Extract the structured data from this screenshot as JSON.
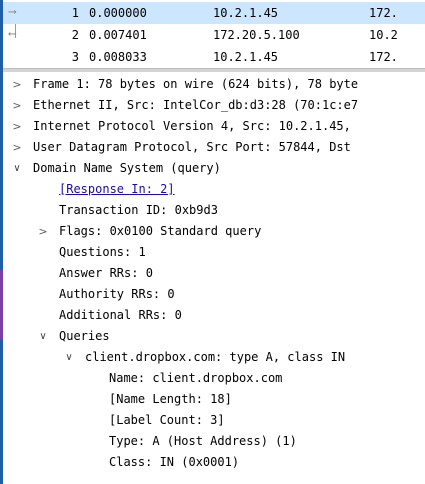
{
  "packets": [
    {
      "no": "1",
      "time": "0.000000",
      "source": "10.2.1.45",
      "destination": "172.",
      "relation": "request"
    },
    {
      "no": "2",
      "time": "0.007401",
      "source": "172.20.5.100",
      "destination": "10.2",
      "relation": "response"
    },
    {
      "no": "3",
      "time": "0.008033",
      "source": "10.2.1.45",
      "destination": "172.",
      "relation": "none"
    }
  ],
  "details": {
    "frame": "Frame 1: 78 bytes on wire (624 bits), 78 byte",
    "ethernet": "Ethernet II, Src: IntelCor_db:d3:28 (70:1c:e7",
    "ip": "Internet Protocol Version 4, Src: 10.2.1.45,",
    "udp": "User Datagram Protocol, Src Port: 57844, Dst",
    "dns": "Domain Name System (query)",
    "response_in": "[Response In: 2]",
    "transaction_id": "Transaction ID: 0xb9d3",
    "flags": "Flags: 0x0100 Standard query",
    "questions": "Questions: 1",
    "answer_rrs": "Answer RRs: 0",
    "authority_rrs": "Authority RRs: 0",
    "additional_rrs": "Additional RRs: 0",
    "queries": "Queries",
    "query": "client.dropbox.com: type A, class IN",
    "name": "Name: client.dropbox.com",
    "name_length": "[Name Length: 18]",
    "label_count": "[Label Count: 3]",
    "type": "Type: A (Host Address) (1)",
    "class": "Class: IN (0x0001)"
  },
  "colors": {
    "selected_row": "#cce6ff",
    "link": "#1a0dab"
  }
}
